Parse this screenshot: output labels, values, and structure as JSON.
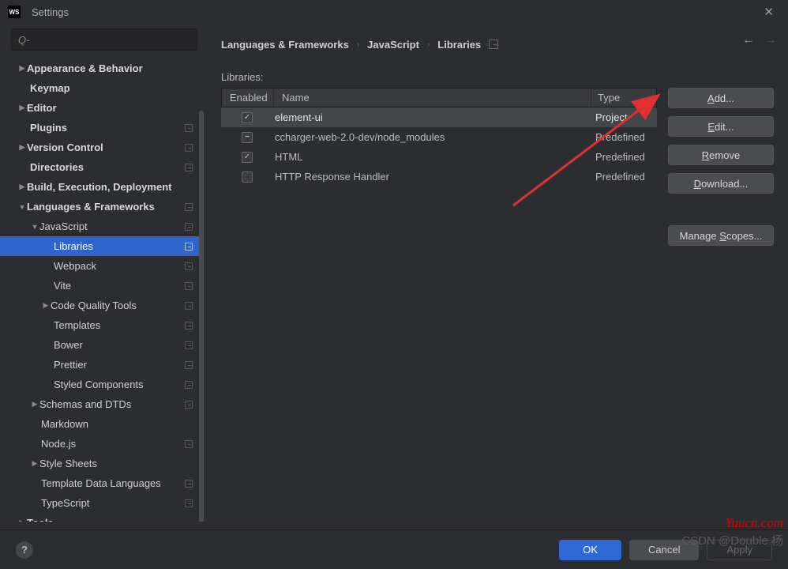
{
  "window": {
    "title": "Settings"
  },
  "search": {
    "placeholder": "Q-"
  },
  "nav": {
    "appearance": "Appearance & Behavior",
    "keymap": "Keymap",
    "editor": "Editor",
    "plugins": "Plugins",
    "vcs": "Version Control",
    "directories": "Directories",
    "build": "Build, Execution, Deployment",
    "langfw": "Languages & Frameworks",
    "js": "JavaScript",
    "libraries": "Libraries",
    "webpack": "Webpack",
    "vite": "Vite",
    "cqt": "Code Quality Tools",
    "templates": "Templates",
    "bower": "Bower",
    "prettier": "Prettier",
    "styled": "Styled Components",
    "schemas": "Schemas and DTDs",
    "markdown": "Markdown",
    "nodejs": "Node.js",
    "stylesheets": "Style Sheets",
    "tdl": "Template Data Languages",
    "ts": "TypeScript",
    "tools": "Tools"
  },
  "crumbs": {
    "a": "Languages & Frameworks",
    "b": "JavaScript",
    "c": "Libraries"
  },
  "libraries_label": "Libraries:",
  "columns": {
    "enabled": "Enabled",
    "name": "Name",
    "type": "Type"
  },
  "rows": [
    {
      "cb": "checked",
      "name": "element-ui",
      "type": "Project",
      "sel": true
    },
    {
      "cb": "mixed",
      "name": "ccharger-web-2.0-dev/node_modules",
      "type": "Predefined",
      "sel": false
    },
    {
      "cb": "checked",
      "name": "HTML",
      "type": "Predefined",
      "sel": false
    },
    {
      "cb": "",
      "name": "HTTP Response Handler",
      "type": "Predefined",
      "sel": false
    }
  ],
  "buttons": {
    "add": "dd...",
    "add_u": "A",
    "edit": "dit...",
    "edit_u": "E",
    "remove": "emove",
    "remove_u": "R",
    "download": "ownload...",
    "download_u": "D",
    "manage": "copes...",
    "manage_pre": "Manage ",
    "manage_u": "S"
  },
  "footer": {
    "ok": "OK",
    "cancel": "Cancel",
    "apply": "Apply"
  },
  "watermark1": "Yuucn.com",
  "watermark2": "CSDN @Double.杨"
}
